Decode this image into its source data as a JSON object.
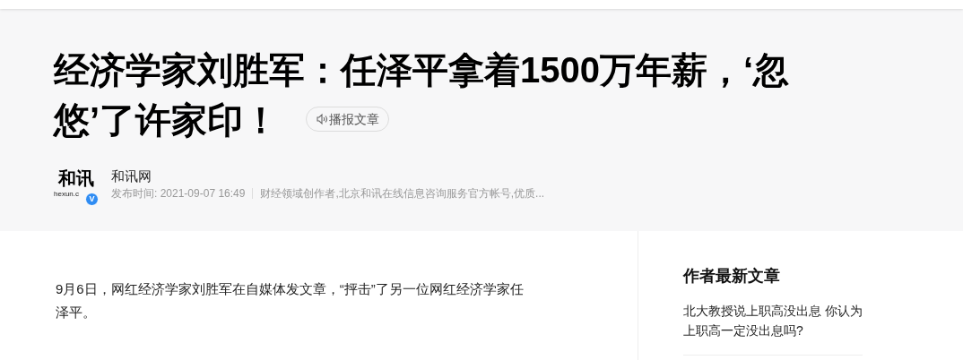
{
  "article": {
    "title": "经济学家刘胜军：任泽平拿着1500万年薪，‘忽悠’了许家印！",
    "listen_button": "播报文章",
    "author": {
      "logo_text": "和讯",
      "logo_subtext": "hexun.c",
      "verified_mark": "V",
      "name": "和讯网",
      "published": "发布时间: 2021-09-07 16:49",
      "description": "财经领域创作者,北京和讯在线信息咨询服务官方帐号,优质..."
    },
    "paragraphs": [
      "9月6日，网红经济学家刘胜军在自媒体发文章，“抨击”了另一位网红经济学家任泽平。"
    ]
  },
  "sidebar": {
    "heading": "作者最新文章",
    "articles": [
      "北大教授说上职高没出息 你认为上职高一定没出息吗?"
    ]
  }
}
